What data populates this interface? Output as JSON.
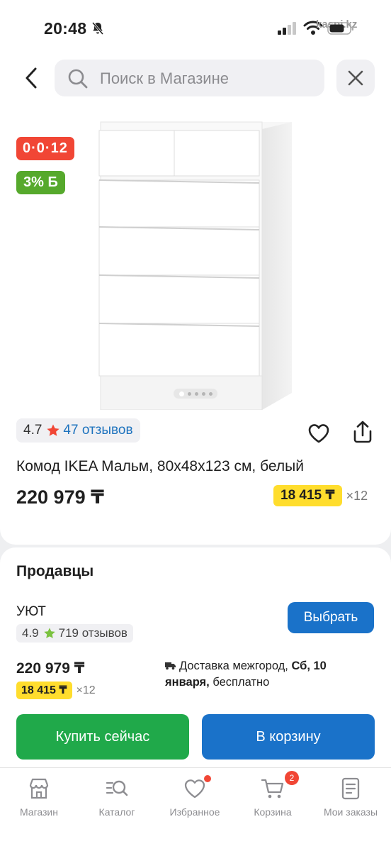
{
  "status_bar": {
    "time": "20:48",
    "watermark": "kaspi.kz"
  },
  "header": {
    "search_placeholder": "Поиск в Магазине",
    "icons": [
      "back-arrow-icon",
      "search-icon",
      "close-icon"
    ]
  },
  "product": {
    "badge_installment": "0·0·12",
    "badge_bonus": "3% Б",
    "image_pager": {
      "total": 5,
      "active_index": 0
    },
    "rating": "4.7",
    "reviews": "47 отзывов",
    "title": "Комод IKEA Мальм, 80x48x123 см, белый",
    "price": "220 979 ₸",
    "monthly_price": "18 415 ₸",
    "monthly_term": "×12"
  },
  "sellers": {
    "title": "Продавцы",
    "seller": {
      "name": "УЮТ",
      "rating": "4.9",
      "reviews": "719 отзывов",
      "choose_label": "Выбрать",
      "price": "220 979 ₸",
      "monthly_price": "18 415 ₸",
      "monthly_term": "×12",
      "delivery_prefix": "Доставка межгород, ",
      "delivery_date": "Сб, 10 января,",
      "delivery_suffix": " бесплатно"
    },
    "buy_now_label": "Купить сейчас",
    "to_cart_label": "В корзину"
  },
  "bottom_nav": {
    "items": [
      {
        "label": "Магазин",
        "icon": "store-icon"
      },
      {
        "label": "Каталог",
        "icon": "catalog-search-icon"
      },
      {
        "label": "Избранное",
        "icon": "heart-icon"
      },
      {
        "label": "Корзина",
        "icon": "cart-icon",
        "badge": "2"
      },
      {
        "label": "Мои заказы",
        "icon": "orders-icon"
      }
    ]
  },
  "colors": {
    "accent_blue": "#1a72c9",
    "buy_green": "#20a94a",
    "installment_red": "#f14635",
    "bonus_green": "#56a92c",
    "installment_yellow": "#ffdd2d",
    "review_link_blue": "#1e73be"
  }
}
